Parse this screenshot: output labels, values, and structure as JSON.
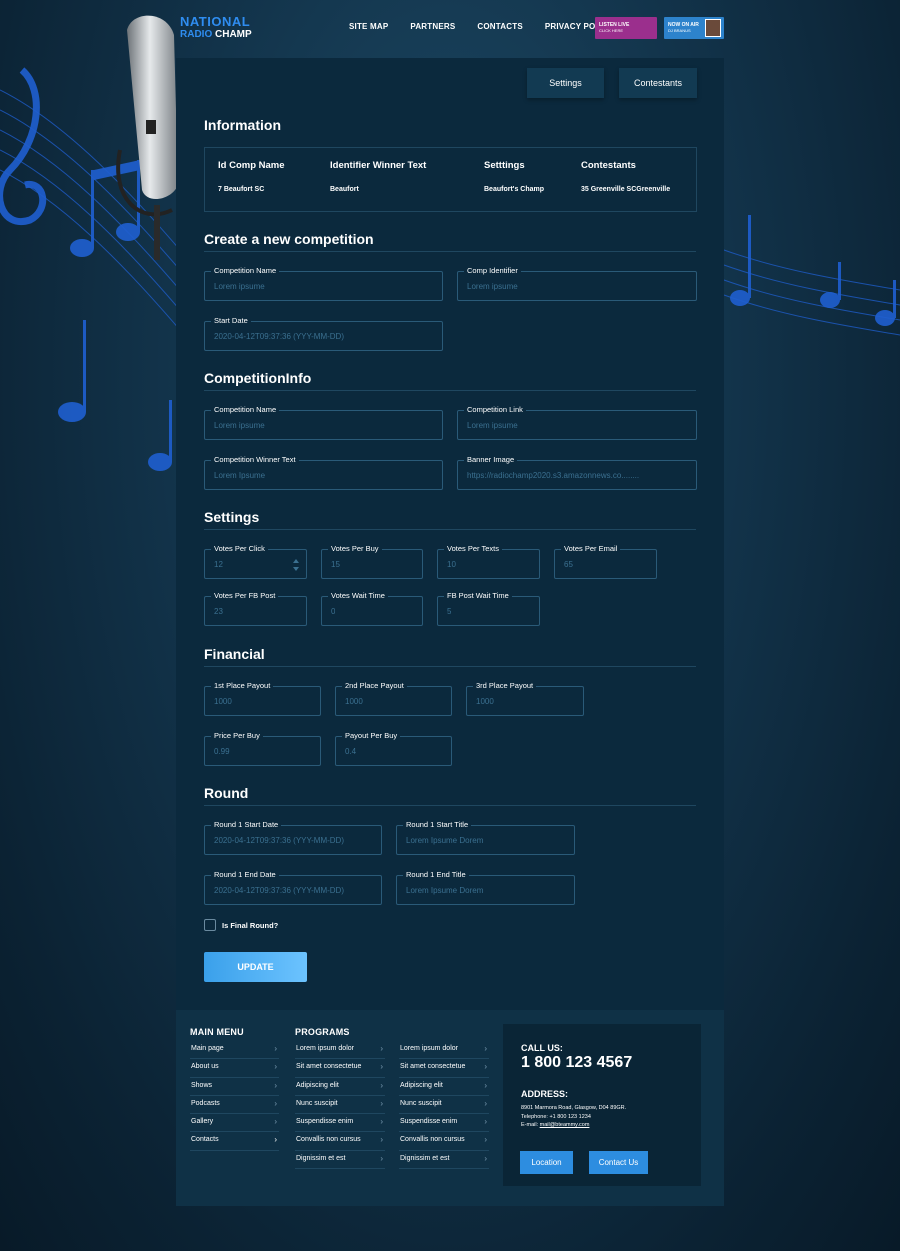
{
  "header": {
    "logo_line1": "NATIONAL",
    "logo_line2_a": "RADIO",
    "logo_line2_b": "CHAMP",
    "nav": [
      "SITE MAP",
      "PARTNERS",
      "CONTACTS",
      "PRIVACY POLICY"
    ],
    "listen_live": "LISTEN LIVE",
    "listen_live_sub": "CLICK HERE",
    "now_on_air": "NOW ON AIR",
    "now_on_air_sub": "DJ BRANUS"
  },
  "tabs": {
    "settings": "Settings",
    "contestants": "Contestants"
  },
  "information": {
    "title": "Information",
    "headers": [
      "Id Comp Name",
      "Identifier Winner Text",
      "Setttings",
      "Contestants"
    ],
    "values": [
      "7 Beaufort SC",
      "Beaufort",
      "Beaufort's Champ",
      "35 Greenville SCGreenville"
    ]
  },
  "create": {
    "title": "Create a new competition",
    "competition_name": {
      "label": "Competition Name",
      "value": "Lorem ipsume"
    },
    "comp_identifier": {
      "label": "Comp Identifier",
      "value": "Lorem ipsume"
    },
    "start_date": {
      "label": "Start Date",
      "value": "2020-04-12T09:37:36 (YYY-MM-DD)"
    }
  },
  "competition_info": {
    "title": "CompetitionInfo",
    "competition_name": {
      "label": "Competition Name",
      "value": "Lorem ipsume"
    },
    "competition_link": {
      "label": "Competition Link",
      "value": "Lorem ipsume"
    },
    "winner_text": {
      "label": "Competition Winner Text",
      "value": "Lorem Ipsume"
    },
    "banner_image": {
      "label": "Banner Image",
      "value": "https://radiochamp2020.s3.amazonnews.co........"
    }
  },
  "settings": {
    "title": "Settings",
    "votes_per_click": {
      "label": "Votes Per Click",
      "value": "12"
    },
    "votes_per_buy": {
      "label": "Votes Per Buy",
      "value": "15"
    },
    "votes_per_texts": {
      "label": "Votes Per Texts",
      "value": "10"
    },
    "votes_per_email": {
      "label": "Votes Per Email",
      "value": "65"
    },
    "votes_per_fb_post": {
      "label": "Votes Per FB Post",
      "value": "23"
    },
    "votes_wait_time": {
      "label": "Votes Wait Time",
      "value": "0"
    },
    "fb_post_wait_time": {
      "label": "FB Post Wait Time",
      "value": "5"
    }
  },
  "financial": {
    "title": "Financial",
    "first_place": {
      "label": "1st Place Payout",
      "value": "1000"
    },
    "second_place": {
      "label": "2nd Place Payout",
      "value": "1000"
    },
    "third_place": {
      "label": "3rd Place Payout",
      "value": "1000"
    },
    "price_per_buy": {
      "label": "Price Per Buy",
      "value": "0.99"
    },
    "payout_per_buy": {
      "label": "Payout Per Buy",
      "value": "0.4"
    }
  },
  "round": {
    "title": "Round",
    "start_date": {
      "label": "Round 1 Start Date",
      "value": "2020-04-12T09:37:36 (YYY-MM-DD)"
    },
    "start_title": {
      "label": "Round 1 Start Title",
      "value": "Lorem Ipsume Dorem"
    },
    "end_date": {
      "label": "Round 1 End Date",
      "value": "2020-04-12T09:37:36 (YYY-MM-DD)"
    },
    "end_title": {
      "label": "Round 1 End Title",
      "value": "Lorem Ipsume Dorem"
    },
    "final_round_label": "Is Final Round?",
    "final_round_checked": false,
    "update_button": "UPDATE"
  },
  "footer": {
    "main_menu_title": "MAIN MENU",
    "main_menu": [
      "Main page",
      "About us",
      "Shows",
      "Podcasts",
      "Gallery",
      "Contacts"
    ],
    "programs_title": "PROGRAMS",
    "programs_col1": [
      "Lorem ipsum dolor",
      "Sit amet consectetue",
      "Adipiscing elit",
      "Nunc suscipit",
      "Suspendisse enim",
      "Convallis non cursus",
      "Dignissim et est"
    ],
    "programs_col2": [
      "Lorem ipsum dolor",
      "Sit amet consectetue",
      "Adipiscing elit",
      "Nunc suscipit",
      "Suspendisse enim",
      "Convallis non cursus",
      "Dignissim et est"
    ],
    "call_us_label": "CALL US:",
    "phone": "1 800 123 4567",
    "address_label": "ADDRESS:",
    "address_line": "8901 Marmora Road, Glasgow, D04 89GR.",
    "telephone_line": "Telephone: +1 800 123 1234",
    "email_prefix": "E-mail: ",
    "email": "mail@bteammy.com",
    "location_button": "Location",
    "contact_button": "Contact Us"
  },
  "colors": {
    "background": "#12334a",
    "panel": "#0b293d",
    "accent": "#2f8df0",
    "notes": "#1f5fd0",
    "listen_live": "#9b2f8d",
    "on_air": "#2d83cc"
  },
  "icons": [
    "microphone-icon",
    "music-note-icon",
    "treble-clef-icon",
    "chevron-right-icon",
    "spinner-arrows-icon"
  ]
}
